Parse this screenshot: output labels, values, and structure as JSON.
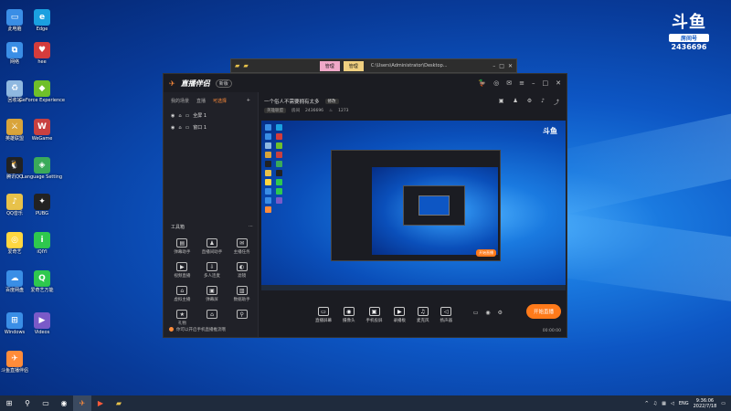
{
  "desktop": {
    "icons": [
      {
        "label": "此电脑",
        "color": "#3a8ee6",
        "glyph": "▭"
      },
      {
        "label": "Edge",
        "color": "#1aa0e0",
        "glyph": "e"
      },
      {
        "label": "网络",
        "color": "#3a8ee6",
        "glyph": "⧉"
      },
      {
        "label": "hee",
        "color": "#d43c3c",
        "glyph": "♥"
      },
      {
        "label": "回收站",
        "color": "#8fb8e0",
        "glyph": "♻"
      },
      {
        "label": "GeForce Experience",
        "color": "#6fbf2a",
        "glyph": "◆"
      },
      {
        "label": "英雄联盟",
        "color": "#d9a43a",
        "glyph": "⚔"
      },
      {
        "label": "WeGame",
        "color": "#c84040",
        "glyph": "W"
      },
      {
        "label": "腾讯QQ",
        "color": "#222",
        "glyph": "🐧"
      },
      {
        "label": "Language Setting",
        "color": "#3aaa5a",
        "glyph": "◈"
      },
      {
        "label": "QQ音乐",
        "color": "#e8c24a",
        "glyph": "♪"
      },
      {
        "label": "PUBG",
        "color": "#222",
        "glyph": "✦"
      },
      {
        "label": "爱奇艺",
        "color": "#ffd740",
        "glyph": "◎"
      },
      {
        "label": "iQIYI",
        "color": "#2ec84e",
        "glyph": "i"
      },
      {
        "label": "百度网盘",
        "color": "#3a8ee6",
        "glyph": "☁"
      },
      {
        "label": "爱奇艺万能",
        "color": "#2ec84e",
        "glyph": "Q"
      },
      {
        "label": "Windows",
        "color": "#3a8ee6",
        "glyph": "⊞"
      },
      {
        "label": "Videos",
        "color": "#7a5ac8",
        "glyph": "▶"
      },
      {
        "label": "斗鱼直播伴侣",
        "color": "#ff8c3a",
        "glyph": "✈"
      }
    ],
    "logo": {
      "mark": "斗鱼",
      "sub": "房间号",
      "room": "2436696"
    }
  },
  "explorer": {
    "tab1": "管理",
    "tab2": "管理",
    "path": "C:\\Users\\Administrator\\Desktop..."
  },
  "app": {
    "brand": "直播伴侣",
    "badge": "新版",
    "tabs": [
      "我的场景",
      "直播",
      "可选择"
    ],
    "scenes": [
      "全屏 1",
      "窗口 1"
    ],
    "tools_header": "工具箱",
    "tools": [
      {
        "label": "弹幕助手",
        "glyph": "▤"
      },
      {
        "label": "直播间助手",
        "glyph": "♟"
      },
      {
        "label": "主播任务",
        "glyph": "✉"
      },
      {
        "label": "视频直播",
        "glyph": "▶"
      },
      {
        "label": "多人连麦",
        "glyph": "⇩"
      },
      {
        "label": "滤镜",
        "glyph": "◐"
      },
      {
        "label": "虚拟主播",
        "glyph": "⌂"
      },
      {
        "label": "弹幕屏",
        "glyph": "▣"
      },
      {
        "label": "数据助手",
        "glyph": "▥"
      },
      {
        "label": "礼物",
        "glyph": "★"
      },
      {
        "label": "",
        "glyph": "⌂"
      },
      {
        "label": "",
        "glyph": "⚲"
      }
    ],
    "notice": "你可以开启手机直播推流哦",
    "room_title": "一个俗人不需要拥有太多",
    "room_edit": "修改",
    "category": "英雄联盟",
    "room_id_label": "房间",
    "room_id": "2436696",
    "hot": "1273",
    "controls": [
      {
        "label": "直播屏幕",
        "glyph": "▭"
      },
      {
        "label": "摄像头",
        "glyph": "◉"
      },
      {
        "label": "手机投屏",
        "glyph": "▣"
      },
      {
        "label": "录播板",
        "glyph": "▶"
      },
      {
        "label": "麦克风",
        "glyph": "♫"
      },
      {
        "label": "扬声器",
        "glyph": "◁"
      }
    ],
    "go_live": "开始直播",
    "timer": "00:00:00"
  },
  "taskbar": {
    "time": "9:36:06",
    "date": "2022/7/18",
    "lang": "ENG"
  }
}
